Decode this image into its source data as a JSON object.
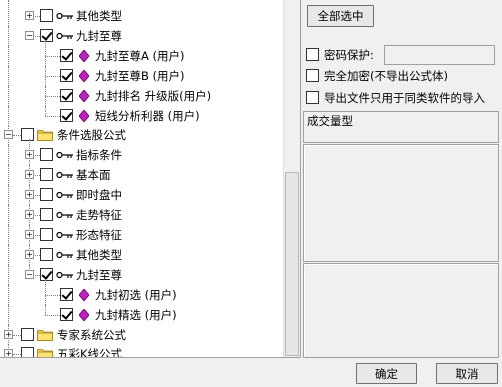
{
  "tree": {
    "items": [
      {
        "label": "其他类型",
        "checked": false,
        "icon": "key-icon",
        "expander": "+"
      },
      {
        "label": "九封至尊",
        "checked": true,
        "icon": "key-icon",
        "expander": "-"
      },
      {
        "label": "九封至尊A (用户)",
        "checked": true,
        "icon": "gem-icon"
      },
      {
        "label": "九封至尊B (用户)",
        "checked": true,
        "icon": "gem-icon"
      },
      {
        "label": "九封排名 升级版(用户)",
        "checked": true,
        "icon": "gem-icon"
      },
      {
        "label": "短线分析利器 (用户)",
        "checked": true,
        "icon": "gem-icon"
      },
      {
        "label": "条件选股公式",
        "checked": false,
        "icon": "folder-icon",
        "expander": "-"
      },
      {
        "label": "指标条件",
        "checked": false,
        "icon": "key-icon",
        "expander": "+"
      },
      {
        "label": "基本面",
        "checked": false,
        "icon": "key-icon",
        "expander": "+"
      },
      {
        "label": "即时盘中",
        "checked": false,
        "icon": "key-icon",
        "expander": "+"
      },
      {
        "label": "走势特征",
        "checked": false,
        "icon": "key-icon",
        "expander": "+"
      },
      {
        "label": "形态特征",
        "checked": false,
        "icon": "key-icon",
        "expander": "+"
      },
      {
        "label": "其他类型",
        "checked": false,
        "icon": "key-icon",
        "expander": "+"
      },
      {
        "label": "九封至尊",
        "checked": true,
        "icon": "key-icon",
        "expander": "-"
      },
      {
        "label": "九封初选 (用户)",
        "checked": true,
        "icon": "gem-icon"
      },
      {
        "label": "九封精选 (用户)",
        "checked": true,
        "icon": "gem-icon"
      },
      {
        "label": "专家系统公式",
        "checked": false,
        "icon": "folder-icon",
        "expander": "+"
      },
      {
        "label": "五彩K线公式",
        "checked": false,
        "icon": "folder-icon",
        "expander": "+"
      }
    ]
  },
  "right_panel": {
    "select_all_label": "全部选中",
    "password_label": "密码保护:",
    "password_value": "",
    "full_encrypt_label": "完全加密(不导出公式体)",
    "same_software_label": "导出文件只用于同类软件的导入",
    "formula_name": "成交量型"
  },
  "footer": {
    "ok_label": "确定",
    "cancel_label": "取消"
  }
}
